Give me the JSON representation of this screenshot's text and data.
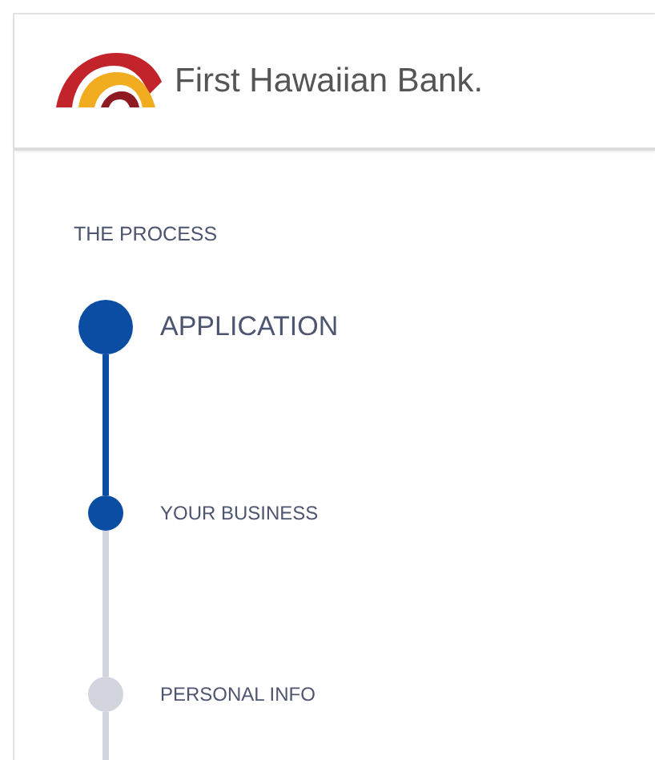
{
  "header": {
    "bank_name": "First Hawaiian Bank."
  },
  "process": {
    "title": "THE PROCESS",
    "steps": [
      {
        "label": "APPLICATION",
        "kind": "section",
        "reached": true
      },
      {
        "label": "YOUR BUSINESS",
        "kind": "step",
        "reached": true
      },
      {
        "label": "PERSONAL INFO",
        "kind": "step",
        "reached": false
      }
    ]
  }
}
